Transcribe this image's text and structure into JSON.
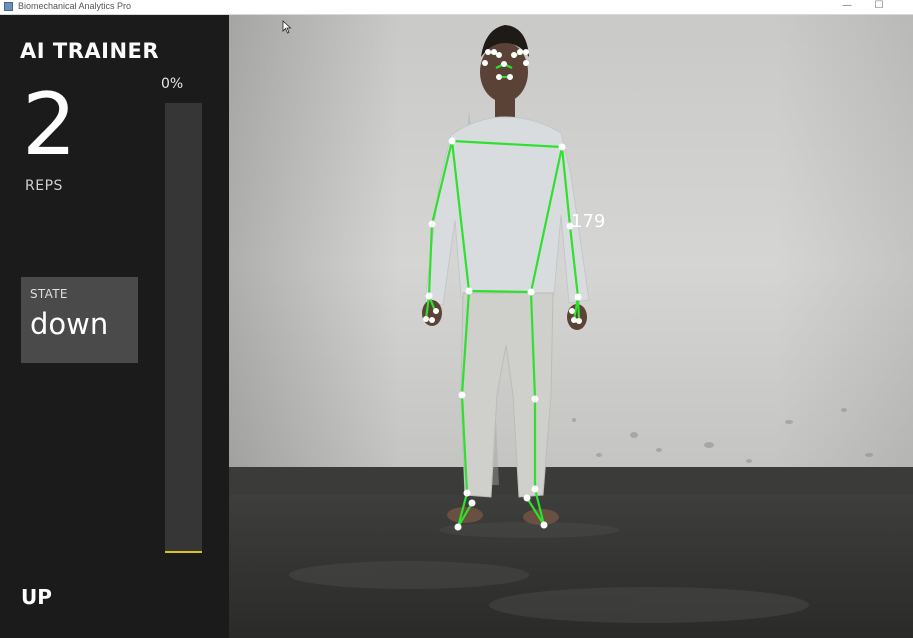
{
  "window": {
    "title": "Biomechanical Analytics Pro",
    "controls": {
      "minimize": "—",
      "maximize": "☐"
    }
  },
  "panel": {
    "app_name": "AI TRAINER",
    "rep_count": "2",
    "reps_label": "REPS",
    "progress_percent_text": "0%",
    "progress_percent": 0,
    "state": {
      "title": "STATE",
      "value": "down"
    },
    "direction": "UP"
  },
  "video": {
    "angle_readout": "179"
  },
  "colors": {
    "skeleton_line": "#2fe02f",
    "joint": "#ffffff",
    "progress_fill": "#e2cc1c",
    "panel_bg": "#1b1b1b"
  }
}
